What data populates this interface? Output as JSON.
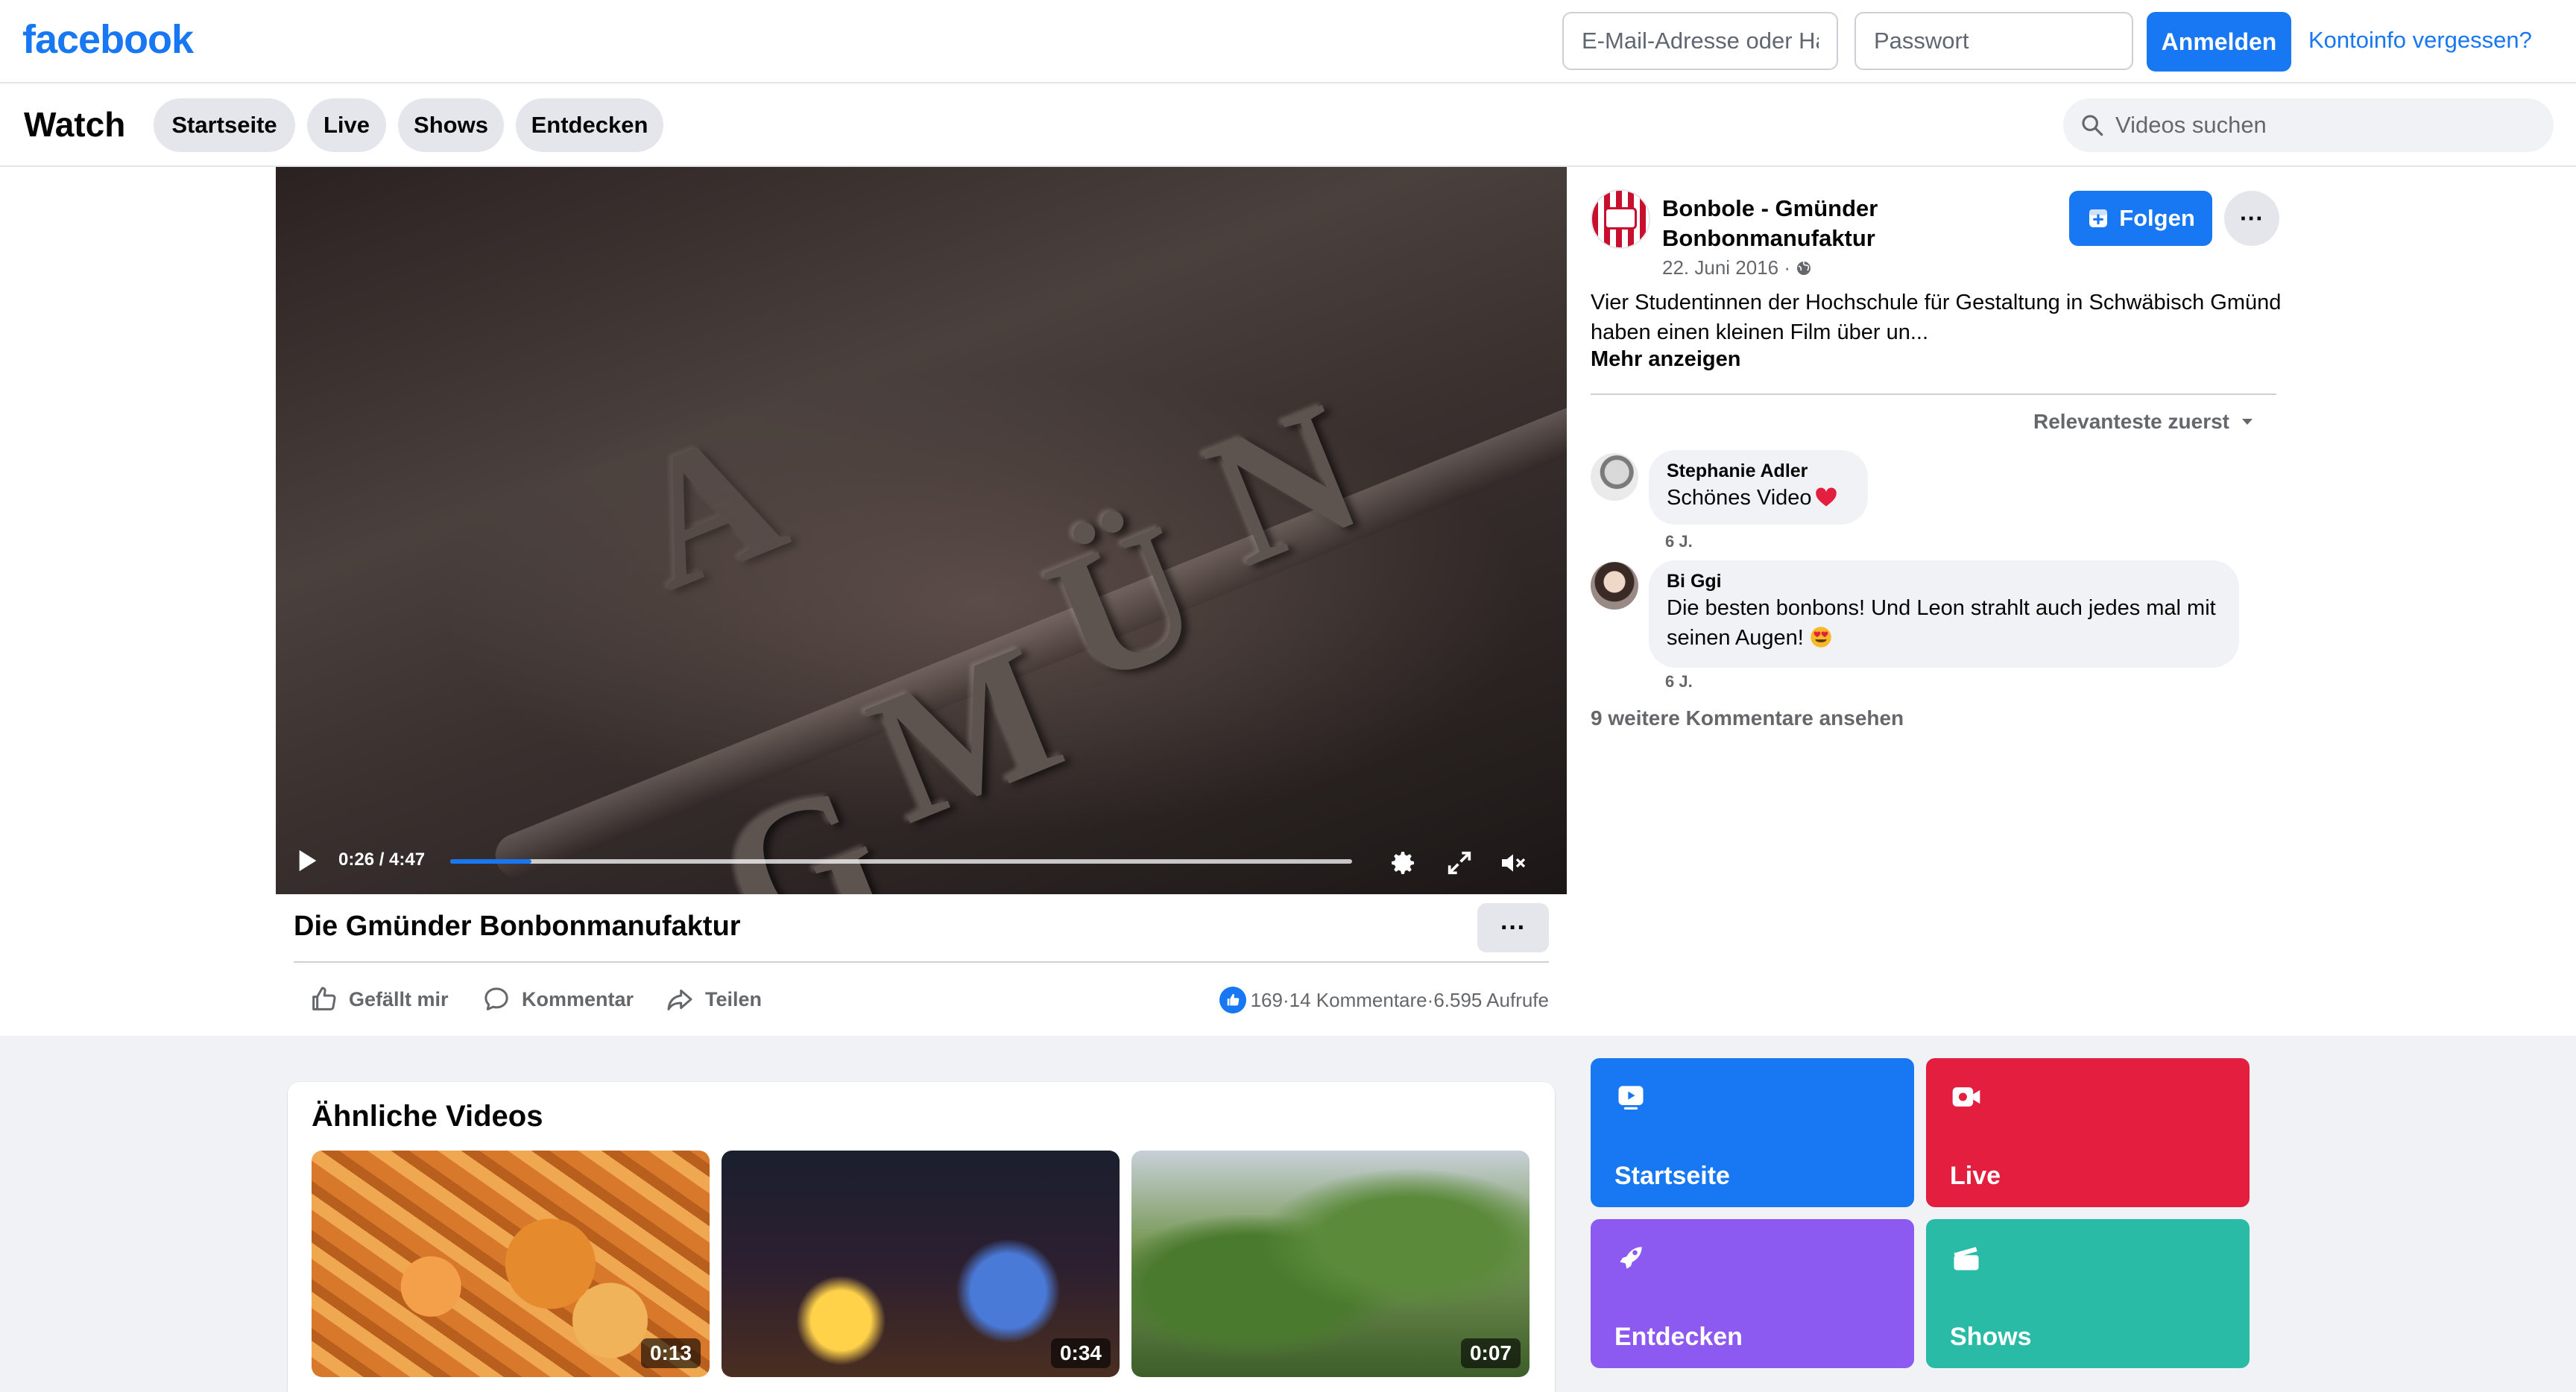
{
  "header": {
    "logo": "facebook",
    "email_placeholder": "E-Mail-Adresse oder Handynummer",
    "password_placeholder": "Passwort",
    "login_label": "Anmelden",
    "forgot_label": "Kontoinfo vergessen?"
  },
  "watch_nav": {
    "title": "Watch",
    "tabs": [
      {
        "label": "Startseite"
      },
      {
        "label": "Live"
      },
      {
        "label": "Shows"
      },
      {
        "label": "Entdecken"
      }
    ],
    "search_placeholder": "Videos suchen"
  },
  "video": {
    "current_time": "0:26",
    "duration": "4:47",
    "time_display": "0:26 / 4:47",
    "progress": 0.09,
    "title": "Die Gmünder Bonbonmanufaktur",
    "more_label": "···"
  },
  "actions": {
    "like_label": "Gefällt mir",
    "comment_label": "Kommentar",
    "share_label": "Teilen"
  },
  "stats": {
    "likes": "169",
    "comments": "14 Kommentare",
    "views": "6.595 Aufrufe",
    "separator": " · "
  },
  "post": {
    "page_name": "Bonbole - Gmünder Bonbonmanufaktur",
    "date": "22. Juni 2016 ·",
    "follow_label": "Folgen",
    "more_label": "···",
    "text": "Vier Studentinnen der Hochschule für Gestaltung in Schwäbisch Gmünd haben einen kleinen Film über un...",
    "see_more_label": "Mehr anzeigen"
  },
  "comments": {
    "sort_label": "Relevanteste zuerst",
    "items": [
      {
        "author": "Stephanie Adler",
        "text": "Schönes Video",
        "time": "6 J."
      },
      {
        "author": "Bi Ggi",
        "text": "Die besten bonbons! Und Leon strahlt auch jedes mal mit seinen Augen!",
        "time": "6 J."
      }
    ],
    "more_label": "9 weitere Kommentare ansehen"
  },
  "similar": {
    "title": "Ähnliche Videos",
    "videos": [
      {
        "duration": "0:13"
      },
      {
        "duration": "0:34"
      },
      {
        "duration": "0:07"
      }
    ]
  },
  "tiles": [
    {
      "label": "Startseite",
      "color": "#1877f2"
    },
    {
      "label": "Live",
      "color": "#e41e3f"
    },
    {
      "label": "Entdecken",
      "color": "#8c5af0"
    },
    {
      "label": "Shows",
      "color": "#2abba7"
    }
  ],
  "colors": {
    "brand": "#1877f2",
    "pill_bg": "#e4e6eb",
    "secondary_text": "#65676b"
  }
}
